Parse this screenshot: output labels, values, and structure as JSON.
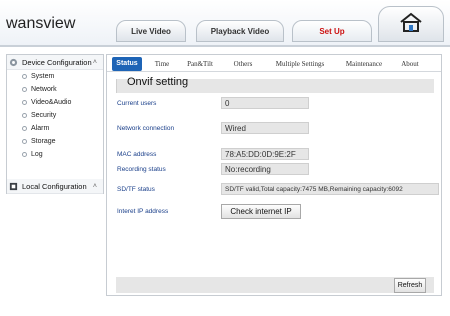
{
  "brand": {
    "logo_left": "wans",
    "logo_right": "view"
  },
  "top_nav": {
    "tabs": [
      {
        "label": "Live Video"
      },
      {
        "label": "Playback Video"
      },
      {
        "label": "Set Up",
        "active": true
      }
    ],
    "home_icon": "home-icon"
  },
  "sidebar": {
    "device_config": {
      "label": "Device Configuration",
      "icon": "gear-icon",
      "expanded": true
    },
    "items": [
      {
        "label": "System"
      },
      {
        "label": "Network"
      },
      {
        "label": "Video&Audio"
      },
      {
        "label": "Security"
      },
      {
        "label": "Alarm"
      },
      {
        "label": "Storage"
      },
      {
        "label": "Log"
      }
    ],
    "local_config": {
      "label": "Local Configuration",
      "icon": "local-config-icon",
      "expanded": true
    }
  },
  "main": {
    "tabs": [
      {
        "label": "Status",
        "active": true
      },
      {
        "label": "Time"
      },
      {
        "label": "Pan&Tilt"
      },
      {
        "label": "Others"
      },
      {
        "label": "Multiple Settings"
      },
      {
        "label": "Maintenance"
      },
      {
        "label": "About"
      }
    ],
    "section_title": "Onvif setting",
    "rows": [
      {
        "label": "Current users",
        "value": "0"
      },
      {
        "label": "Network connection",
        "value": "Wired"
      },
      {
        "label": "MAC address",
        "value": "78:A5:DD:0D:9E:2F"
      },
      {
        "label": "Recording status",
        "value": "No:recording"
      },
      {
        "label": "SD/TF status",
        "value": "SD/TF valid,Total capacity:7475 MB,Remaining capacity:6092"
      },
      {
        "label": "Interet IP address",
        "button": "Check internet IP"
      }
    ],
    "refresh_label": "Refresh"
  },
  "colors": {
    "accent": "#1e64b6",
    "active_nav": "#cc1111",
    "label_blue": "#1a3f8a"
  }
}
